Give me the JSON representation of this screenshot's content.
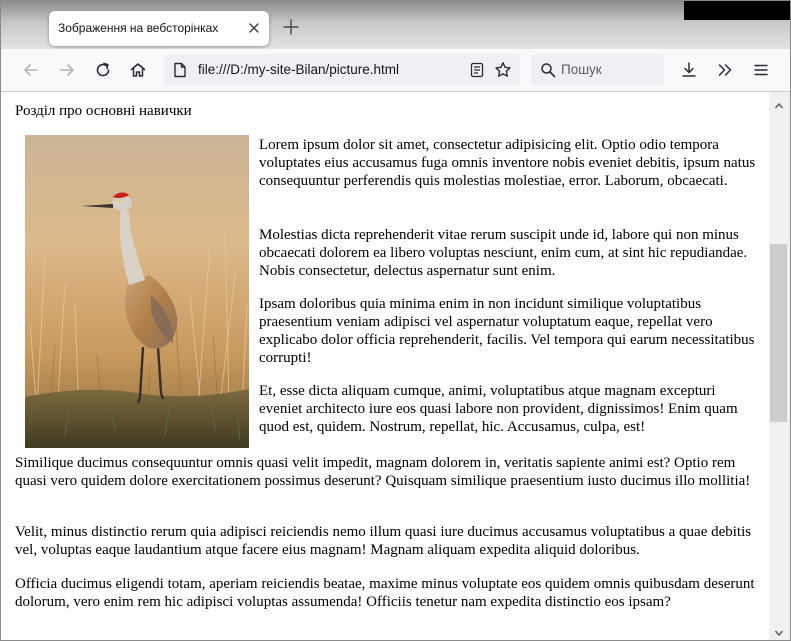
{
  "tab": {
    "title": "Зображення на вебсторінках"
  },
  "toolbar": {
    "url": "file:///D:/my-site-Bilan/picture.html",
    "search_placeholder": "Пошук"
  },
  "page": {
    "heading": "Розділ про основні навички",
    "paragraphs_right": [
      "Lorem ipsum dolor sit amet, consectetur adipisicing elit. Optio odio tempora voluptates eius accusamus fuga omnis inventore nobis eveniet debitis, ipsum natus consequuntur perferendis quis molestias molestiae, error. Laborum, obcaecati.",
      "Molestias dicta reprehenderit vitae rerum suscipit unde id, labore qui non minus obcaecati dolorem ea libero voluptas nesciunt, enim cum, at sint hic repudiandae. Nobis consectetur, delectus aspernatur sunt enim.",
      "Ipsam doloribus quia minima enim in non incidunt similique voluptatibus praesentium veniam adipisci vel aspernatur voluptatum eaque, repellat vero explicabo dolor officia reprehenderit, facilis. Vel tempora qui earum necessitatibus corrupti!",
      "Et, esse dicta aliquam cumque, animi, voluptatibus atque magnam excepturi eveniet architecto iure eos quasi labore non provident, dignissimos! Enim quam quod est, quidem. Nostrum, repellat, hic. Accusamus, culpa, est!"
    ],
    "paragraphs_full": [
      "Similique ducimus consequuntur omnis quasi velit impedit, magnam dolorem in, veritatis sapiente animi est? Optio rem quasi vero quidem dolore exercitationem possimus deserunt? Quisquam similique praesentium iusto ducimus illo mollitia!",
      "Velit, minus distinctio rerum quia adipisci reiciendis nemo illum quasi iure ducimus accusamus voluptatibus a quae debitis vel, voluptas eaque laudantium atque facere eius magnam! Magnam aliquam expedita aliquid doloribus.",
      "Officia ducimus eligendi totam, aperiam reiciendis beatae, maxime minus voluptate eos quidem omnis quibusdam deserunt dolorum, vero enim rem hic adipisci voluptas assumenda! Officiis tenetur nam expedita distinctio eos ipsam?"
    ]
  },
  "icons": {
    "back": "back-arrow-icon",
    "forward": "forward-arrow-icon",
    "reload": "reload-icon",
    "home": "home-icon",
    "page": "page-icon",
    "reader": "reader-view-icon",
    "bookmark": "star-icon",
    "search": "search-icon",
    "downloads": "download-icon",
    "overflow": "chevrons-right-icon",
    "menu": "hamburger-menu-icon"
  }
}
